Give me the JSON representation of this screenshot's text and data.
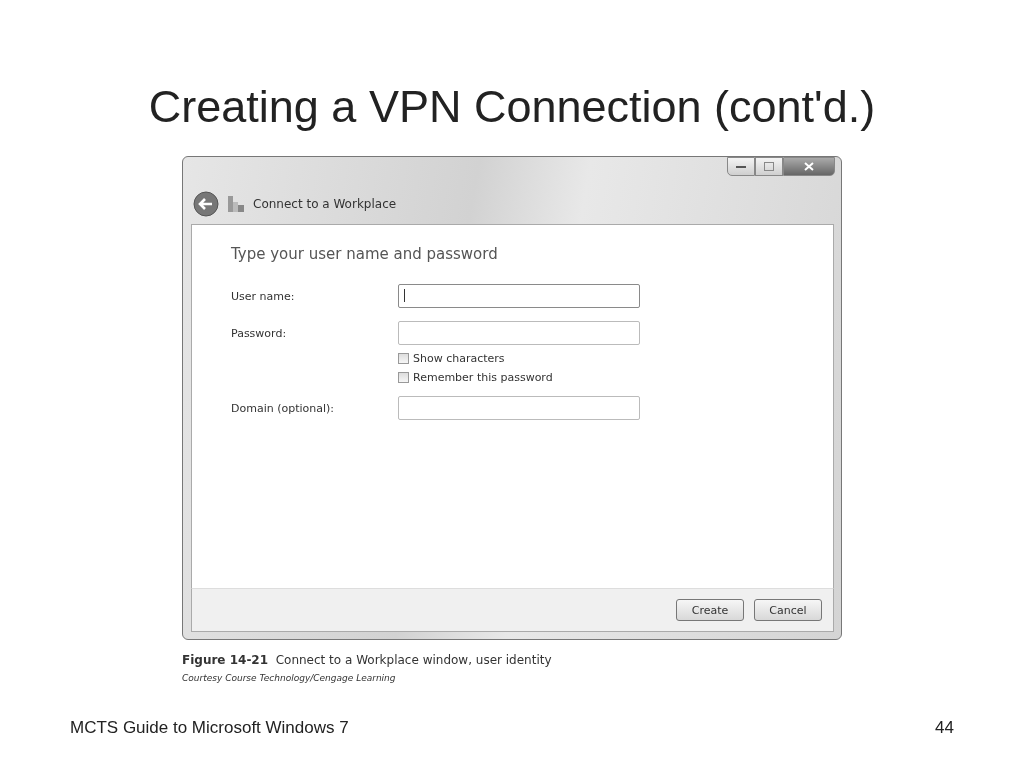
{
  "slide_title": "Creating a VPN Connection (cont'd.)",
  "window": {
    "title": "Connect to a Workplace",
    "heading": "Type your user name and password",
    "fields": [
      {
        "label": "User name:",
        "focused": true
      },
      {
        "label": "Password:",
        "focused": false
      }
    ],
    "checkboxes": [
      {
        "label": "Show characters",
        "checked": false
      },
      {
        "label": "Remember this password",
        "checked": false
      }
    ],
    "domain_field": {
      "label": "Domain (optional):",
      "focused": false
    },
    "buttons": [
      "Create",
      "Cancel"
    ]
  },
  "caption": "**Figure 14-21**  Connect to a Workplace window, user identity",
  "credit": "Courtesy Course Technology/Cengage Learning",
  "footer": {
    "left": "MCTS Guide to Microsoft Windows 7",
    "page": "44"
  }
}
